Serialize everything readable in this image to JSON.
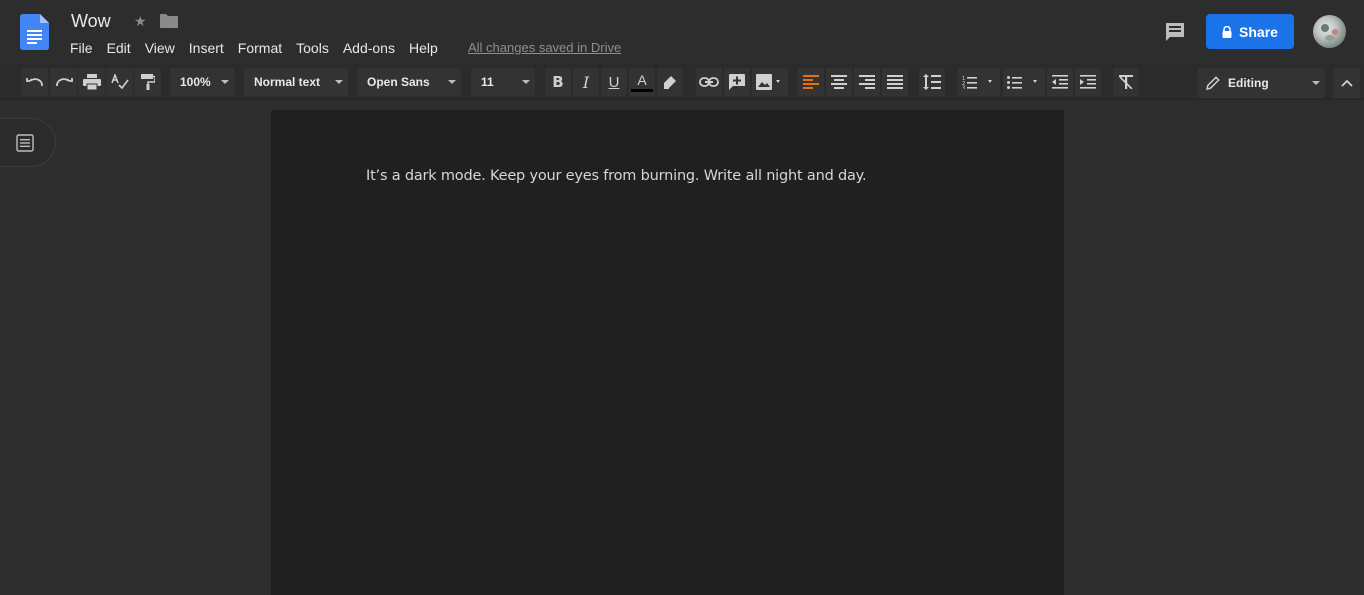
{
  "header": {
    "doc_title": "Wow",
    "menu": [
      "File",
      "Edit",
      "View",
      "Insert",
      "Format",
      "Tools",
      "Add-ons",
      "Help"
    ],
    "save_status": "All changes saved in Drive",
    "share_label": "Share"
  },
  "toolbar": {
    "zoom": "100%",
    "style": "Normal text",
    "font": "Open Sans",
    "font_size": "11",
    "mode": "Editing",
    "accent_color": "#e8710a"
  },
  "document": {
    "body_text": "It’s a dark mode. Keep your eyes from burning. Write all night and day."
  },
  "colors": {
    "background": "#2d2d2d",
    "page": "#202020",
    "share_button": "#1a73e8",
    "docs_blue": "#4285f4"
  }
}
